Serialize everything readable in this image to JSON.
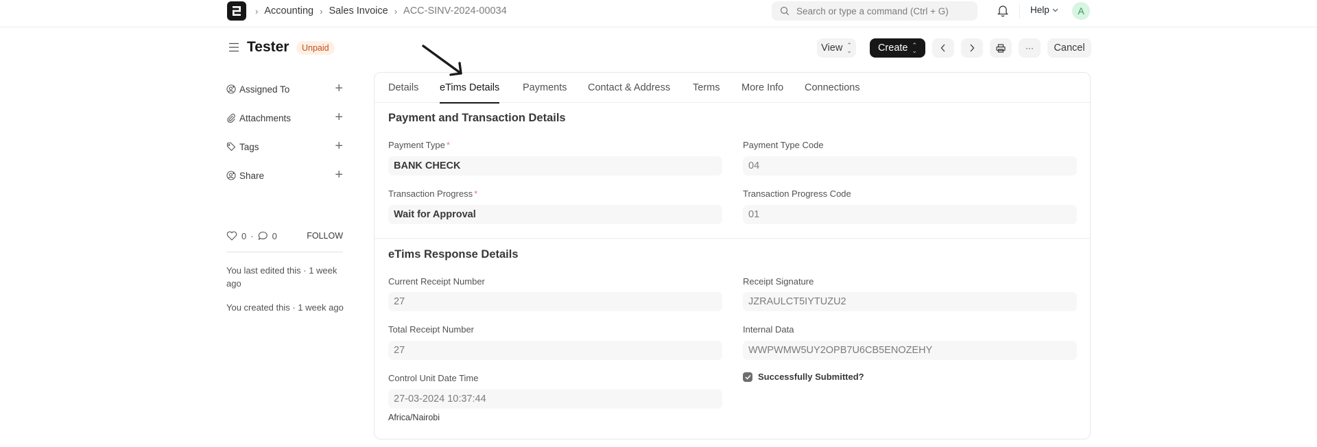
{
  "navbar": {
    "logo_letter": "E",
    "breadcrumbs": [
      "Accounting",
      "Sales Invoice",
      "ACC-SINV-2024-00034"
    ],
    "search_placeholder": "Search or type a command (Ctrl + G)",
    "help_label": "Help",
    "avatar_initial": "A",
    "icons": [
      "search-icon",
      "bell-icon",
      "chevron-down-icon"
    ]
  },
  "page": {
    "title": "Tester",
    "status": "Unpaid",
    "status_color": "#c4501b",
    "actions": {
      "view_label": "View",
      "create_label": "Create",
      "prev_icon": "chevron-left-icon",
      "next_icon": "chevron-right-icon",
      "print_icon": "printer-icon",
      "more_label": "···",
      "cancel_label": "Cancel"
    }
  },
  "sidebar": {
    "items": [
      {
        "label": "Assigned To",
        "icon": "assign-user-icon"
      },
      {
        "label": "Attachments",
        "icon": "paperclip-icon"
      },
      {
        "label": "Tags",
        "icon": "tag-icon"
      },
      {
        "label": "Share",
        "icon": "share-user-icon"
      }
    ],
    "likes": "0",
    "comments": "0",
    "separator": "·",
    "follow_label": "FOLLOW",
    "activity": [
      "You last edited this · 1 week ago",
      "You created this · 1 week ago"
    ]
  },
  "tabs": [
    {
      "label": "Details",
      "active": false
    },
    {
      "label": "eTims Details",
      "active": true
    },
    {
      "label": "Payments",
      "active": false
    },
    {
      "label": "Contact & Address",
      "active": false
    },
    {
      "label": "Terms",
      "active": false
    },
    {
      "label": "More Info",
      "active": false
    },
    {
      "label": "Connections",
      "active": false
    }
  ],
  "sections": {
    "payment": {
      "title": "Payment and Transaction Details",
      "fields": {
        "payment_type": {
          "label": "Payment Type",
          "required": "*",
          "value": "BANK CHECK"
        },
        "payment_type_code": {
          "label": "Payment Type Code",
          "value": "04"
        },
        "transaction_progress": {
          "label": "Transaction Progress",
          "required": "*",
          "value": "Wait for Approval"
        },
        "transaction_progress_code": {
          "label": "Transaction Progress Code",
          "value": "01"
        }
      }
    },
    "response": {
      "title": "eTims Response Details",
      "fields": {
        "current_receipt_number": {
          "label": "Current Receipt Number",
          "value": "27"
        },
        "receipt_signature": {
          "label": "Receipt Signature",
          "value": "JZRAULCT5IYTUZU2"
        },
        "total_receipt_number": {
          "label": "Total Receipt Number",
          "value": "27"
        },
        "internal_data": {
          "label": "Internal Data",
          "value": "WWPWMW5UY2OPB7U6CB5ENOZEHY"
        },
        "control_unit_date_time": {
          "label": "Control Unit Date Time",
          "value": "27-03-2024 10:37:44",
          "timezone": "Africa/Nairobi"
        },
        "successfully_submitted": {
          "label": "Successfully Submitted?",
          "checked": true
        }
      }
    }
  }
}
